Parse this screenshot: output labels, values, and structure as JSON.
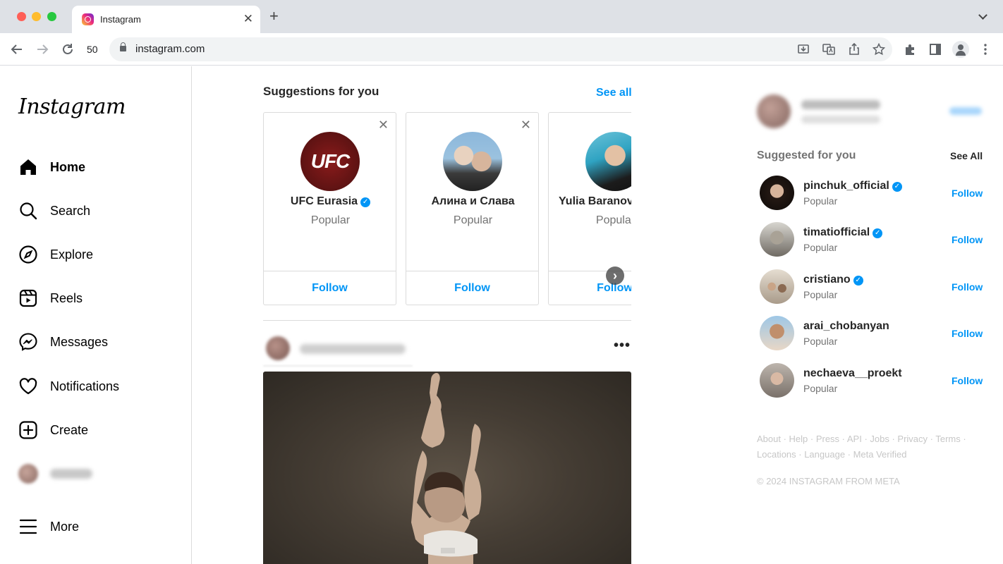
{
  "browser": {
    "tab_title": "Instagram",
    "tab_close": "✕",
    "new_tab": "+",
    "zoom": "50",
    "url": "instagram.com"
  },
  "sidebar": {
    "logo": "Instagram",
    "items": [
      {
        "label": "Home",
        "icon": "home-icon"
      },
      {
        "label": "Search",
        "icon": "search-icon"
      },
      {
        "label": "Explore",
        "icon": "compass-icon"
      },
      {
        "label": "Reels",
        "icon": "reels-icon"
      },
      {
        "label": "Messages",
        "icon": "messenger-icon"
      },
      {
        "label": "Notifications",
        "icon": "heart-icon"
      },
      {
        "label": "Create",
        "icon": "plus-square-icon"
      },
      {
        "label": "More",
        "icon": "menu-icon"
      }
    ]
  },
  "suggestions": {
    "title": "Suggestions for you",
    "see_all": "See all",
    "cards": [
      {
        "name": "UFC Eurasia",
        "verified": true,
        "subtitle": "Popular",
        "follow": "Follow",
        "avatar_text": "UFC"
      },
      {
        "name": "Алина и Слава",
        "verified": false,
        "subtitle": "Popular",
        "follow": "Follow"
      },
      {
        "name": "Yulia Baranovs",
        "verified": false,
        "subtitle": "Popular",
        "follow": "Follow"
      }
    ]
  },
  "post": {
    "more": "•••"
  },
  "right": {
    "suggested_title": "Suggested for you",
    "see_all": "See All",
    "users": [
      {
        "name": "pinchuk_official",
        "verified": true,
        "subtitle": "Popular",
        "follow": "Follow"
      },
      {
        "name": "timatiofficial",
        "verified": true,
        "subtitle": "Popular",
        "follow": "Follow"
      },
      {
        "name": "cristiano",
        "verified": true,
        "subtitle": "Popular",
        "follow": "Follow"
      },
      {
        "name": "arai_chobanyan",
        "verified": false,
        "subtitle": "Popular",
        "follow": "Follow"
      },
      {
        "name": "nechaeva__proekt",
        "verified": false,
        "subtitle": "Popular",
        "follow": "Follow"
      }
    ],
    "footer_links": "About · Help · Press · API · Jobs · Privacy · Terms · Locations · Language · Meta Verified",
    "copyright": "© 2024 INSTAGRAM FROM META"
  },
  "colors": {
    "accent": "#0095f6",
    "muted": "#737373",
    "border": "#dbdbdb"
  }
}
